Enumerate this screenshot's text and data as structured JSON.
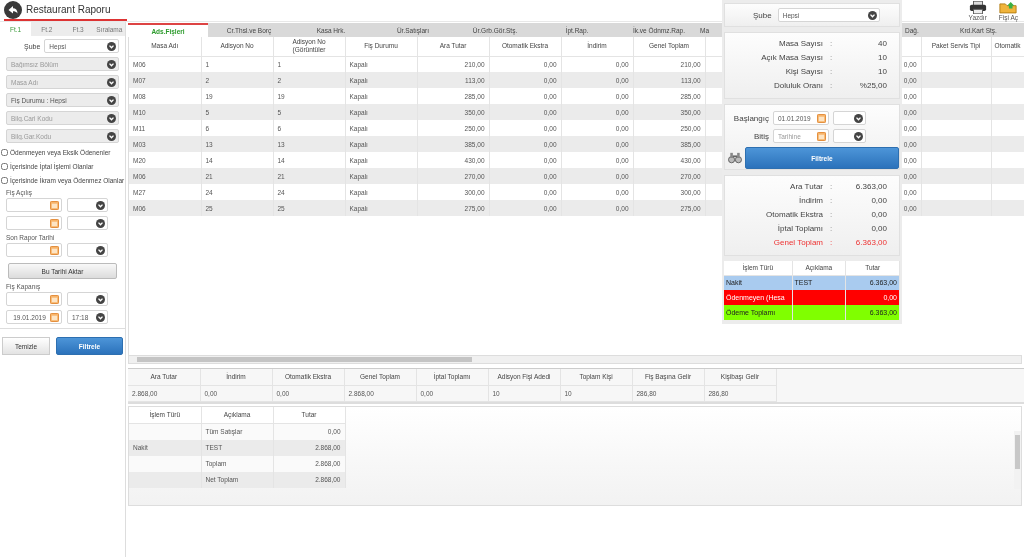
{
  "header": {
    "title": "Restaurant Raporu",
    "actions": [
      {
        "label": "Yazdır",
        "kind": "print"
      },
      {
        "label": "Fişi Aç",
        "kind": "open"
      }
    ]
  },
  "filter_panel": {
    "tabs": [
      {
        "label": "Ft.1",
        "selected": true
      },
      {
        "label": "Ft.2",
        "selected": false
      },
      {
        "label": "Ft.3",
        "selected": false
      },
      {
        "label": "Sıralama",
        "selected": false
      }
    ],
    "branch": {
      "label": "Şube",
      "value": "Hepsi"
    },
    "selects": [
      {
        "placeholder": "Bağımsız Bölüm"
      },
      {
        "placeholder": "Masa Adı"
      },
      {
        "value": "Fiş Durumu : Hepsi"
      },
      {
        "placeholder": "Bilg.Cari Kodu"
      },
      {
        "placeholder": "Bilg.Gar.Kodu"
      }
    ],
    "checkboxes": [
      {
        "label": "Ödenmeyen veya Eksik Ödenenler",
        "checked": false
      },
      {
        "label": "İçerisinde İptal İşlemi Olanlar",
        "checked": false
      },
      {
        "label": "İçerisinde İkram veya Ödenmez Olanlar",
        "checked": false
      }
    ],
    "fields": [
      {
        "kind": "label",
        "text": "Fiş Açılış"
      },
      {
        "kind": "date_time"
      },
      {
        "kind": "date_time"
      },
      {
        "kind": "label",
        "text": "Son Rapor Tarihi"
      },
      {
        "kind": "date_time"
      },
      {
        "kind": "button",
        "text": "Bu Tarihi Aktar"
      },
      {
        "kind": "label",
        "text": "Fiş Kapanış"
      },
      {
        "kind": "date_time"
      },
      {
        "kind": "date_time",
        "date": "19.01.2019",
        "time": "17:18"
      }
    ],
    "buttons": [
      {
        "label": "Temizle",
        "kind": "secondary"
      },
      {
        "label": "Filtrele",
        "kind": "primary"
      }
    ]
  },
  "report": {
    "tabs": [
      {
        "label": "Ads.Fişleri",
        "selected": true
      },
      {
        "label": "Cr.Thsl.ve Borç",
        "selected": false
      },
      {
        "label": "Kasa Hrk.",
        "selected": false
      },
      {
        "label": "Ür.Satışları",
        "selected": false
      },
      {
        "label": "Ür.Grb.Gör.Stş.",
        "selected": false
      },
      {
        "label": "İpt.Rap.",
        "selected": false
      },
      {
        "label": "İk.ve Ödnmz.Rap.",
        "selected": false
      },
      {
        "label": "Ma",
        "selected": false
      },
      {
        "label": "Dağ.",
        "selected": false
      },
      {
        "label": "Krd.Kart Stş.",
        "selected": false
      }
    ],
    "table": {
      "columns": [
        {
          "header": "Masa Adı",
          "kind": "text"
        },
        {
          "header": "Adisyon No",
          "kind": "text"
        },
        {
          "header": "Adisyon No (Görüntüler",
          "kind": "text"
        },
        {
          "header": "Fiş Durumu",
          "kind": "text"
        },
        {
          "header": "Ara Tutar",
          "kind": "amount"
        },
        {
          "header": "Otomatik Ekstra",
          "kind": "amount"
        },
        {
          "header": "İndirim",
          "kind": "amount"
        },
        {
          "header": "Genel Toplam",
          "kind": "amount"
        },
        {
          "kind": "amount"
        },
        {
          "header": "Paket Servis Tipi",
          "kind": "text"
        },
        {
          "header": "Otomatik",
          "kind": "text"
        }
      ],
      "rows": [
        [
          "M06",
          "1",
          "1",
          "Kapalı",
          "210,00",
          "0,00",
          "0,00",
          "210,00",
          "0,00"
        ],
        [
          "M07",
          "2",
          "2",
          "Kapalı",
          "113,00",
          "0,00",
          "0,00",
          "113,00",
          "0,00"
        ],
        [
          "M08",
          "19",
          "19",
          "Kapalı",
          "285,00",
          "0,00",
          "0,00",
          "285,00",
          "0,00"
        ],
        [
          "M10",
          "5",
          "5",
          "Kapalı",
          "350,00",
          "0,00",
          "0,00",
          "350,00",
          "0,00"
        ],
        [
          "M11",
          "6",
          "6",
          "Kapalı",
          "250,00",
          "0,00",
          "0,00",
          "250,00",
          "0,00"
        ],
        [
          "M03",
          "13",
          "13",
          "Kapalı",
          "385,00",
          "0,00",
          "0,00",
          "385,00",
          "0,00"
        ],
        [
          "M20",
          "14",
          "14",
          "Kapalı",
          "430,00",
          "0,00",
          "0,00",
          "430,00",
          "0,00"
        ],
        [
          "M06",
          "21",
          "21",
          "Kapalı",
          "270,00",
          "0,00",
          "0,00",
          "270,00",
          "0,00"
        ],
        [
          "M27",
          "24",
          "24",
          "Kapalı",
          "300,00",
          "0,00",
          "0,00",
          "300,00",
          "0,00"
        ],
        [
          "M06",
          "25",
          "25",
          "Kapalı",
          "275,00",
          "0,00",
          "0,00",
          "275,00",
          "0,00"
        ]
      ]
    },
    "summary": {
      "columns": [
        "Ara Tutar",
        "İndirim",
        "Otomatik Ekstra",
        "Genel Toplam",
        "İptal Toplamı",
        "Adisyon Fişi Adedi",
        "Toplam Kişi",
        "Fiş Başına Gelir",
        "Kişibaşı Gelir"
      ],
      "values": [
        "2.868,00",
        "0,00",
        "0,00",
        "2.868,00",
        "0,00",
        "10",
        "10",
        "286,80",
        "286,80"
      ]
    },
    "payments": {
      "columns": [
        {
          "header": "İşlem Türü",
          "kind": "text"
        },
        {
          "header": "Açıklama",
          "kind": "text"
        },
        {
          "header": "Tutar",
          "kind": "amount"
        }
      ],
      "rows": [
        [
          null,
          "Tüm Satışlar",
          "0,00"
        ],
        [
          "Nakit",
          "TEST",
          "2.868,00"
        ],
        [
          null,
          "Toplam",
          "2.868,00"
        ],
        [
          null,
          "Net Toplam",
          "2.868,00"
        ]
      ]
    }
  },
  "side_panel": {
    "branch": {
      "label": "Şube",
      "value": "Hepsi"
    },
    "stats": [
      {
        "label": "Masa Sayısı",
        "colon": ":",
        "value": "40"
      },
      {
        "label": "Açık Masa Sayısı",
        "colon": ":",
        "value": "10"
      },
      {
        "label": "Kişi Sayısı",
        "colon": ":",
        "value": "10"
      },
      {
        "label": "Doluluk Oranı",
        "colon": ":",
        "value": "%25,00"
      }
    ],
    "dates": [
      {
        "label": "Başlangıç",
        "value": "01.01.2019"
      },
      {
        "label": "Bitiş",
        "placeholder": "Tarihine"
      }
    ],
    "filter_button": "Filtrele",
    "totals": [
      {
        "label": "Ara Tutar",
        "colon": ":",
        "value": "6.363,00",
        "kind": "line"
      },
      {
        "label": "İndirim",
        "colon": ":",
        "value": "0,00",
        "kind": "line"
      },
      {
        "label": "Otomatik Ekstra",
        "colon": ":",
        "value": "0,00",
        "kind": "line"
      },
      {
        "label": "İptal Toplamı",
        "colon": ":",
        "value": "0,00",
        "kind": "line"
      },
      {
        "label": "Genel Toplam",
        "colon": ":",
        "value": "6.363,00",
        "kind": "grand_total"
      }
    ],
    "payments": {
      "columns": [
        "İşlem Türü",
        "Açıklama",
        "Tutar"
      ],
      "rows": [
        {
          "cells": [
            "Nakit",
            "TEST",
            "6.363,00"
          ],
          "color": "#a9cbef"
        },
        {
          "cells": [
            "Ödenmeyen (Hesa",
            null,
            "0,00"
          ],
          "color": "#ff0000"
        },
        {
          "cells": [
            "Ödeme Toplamı",
            null,
            "6.363,00"
          ],
          "color": "#80ff00"
        }
      ]
    }
  }
}
